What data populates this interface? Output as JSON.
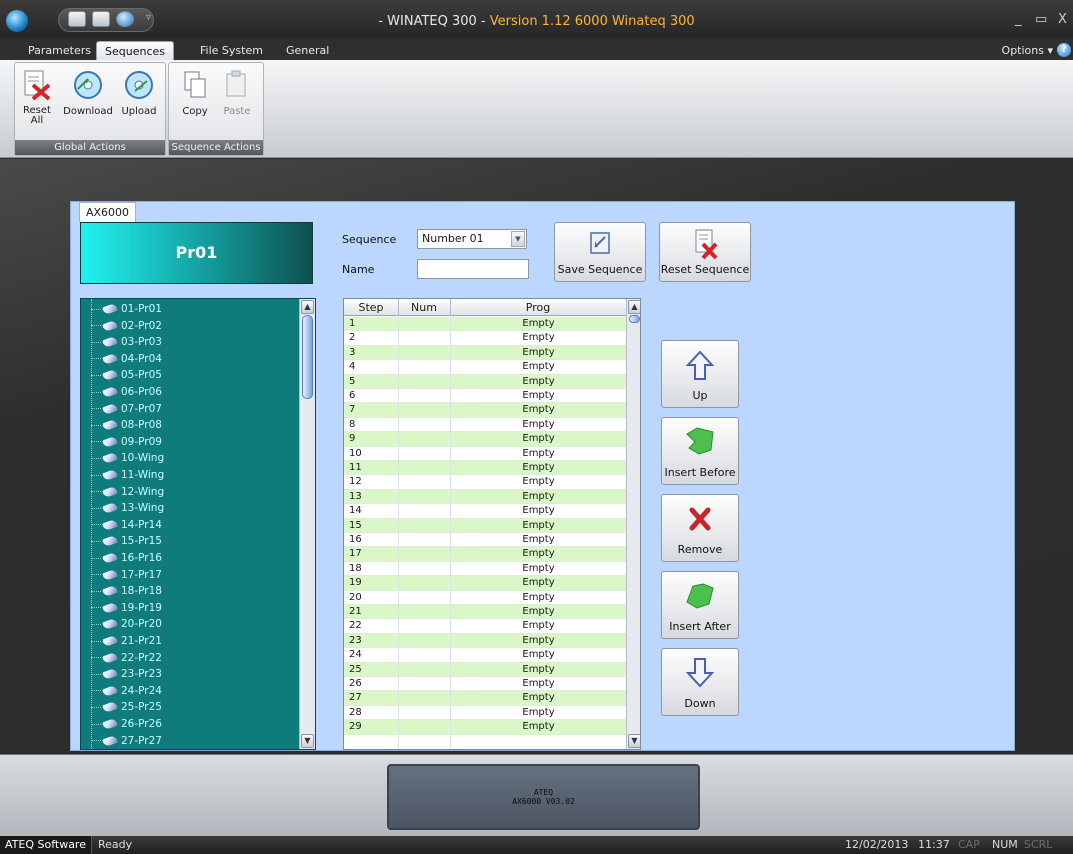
{
  "window": {
    "title_prefix": "- WINATEQ 300 -",
    "title_version": "Version 1.12 6000 Winateq 300",
    "minimize": "_",
    "maximize": "▭",
    "close": "X"
  },
  "tabs": [
    {
      "label": "Parameters"
    },
    {
      "label": "Sequences"
    },
    {
      "label": "File System"
    },
    {
      "label": "General"
    }
  ],
  "options_label": "Options ▾",
  "ribbon": {
    "global_actions": {
      "label": "Global Actions",
      "buttons": [
        {
          "label": "Reset\nAll",
          "icon": "reset-all-icon"
        },
        {
          "label": "Download",
          "icon": "download-disc-icon"
        },
        {
          "label": "Upload",
          "icon": "upload-disc-icon"
        }
      ]
    },
    "sequence_actions": {
      "label": "Sequence Actions",
      "buttons": [
        {
          "label": "Copy",
          "icon": "copy-icon"
        },
        {
          "label": "Paste",
          "icon": "paste-icon"
        }
      ]
    }
  },
  "device_tab": "AX6000",
  "program_header": "Pr01",
  "tree_items": [
    "01-Pr01",
    "02-Pr02",
    "03-Pr03",
    "04-Pr04",
    "05-Pr05",
    "06-Pr06",
    "07-Pr07",
    "08-Pr08",
    "09-Pr09",
    "10-Wing",
    "11-Wing",
    "12-Wing",
    "13-Wing",
    "14-Pr14",
    "15-Pr15",
    "16-Pr16",
    "17-Pr17",
    "18-Pr18",
    "19-Pr19",
    "20-Pr20",
    "21-Pr21",
    "22-Pr22",
    "23-Pr23",
    "24-Pr24",
    "25-Pr25",
    "26-Pr26",
    "27-Pr27"
  ],
  "sequence": {
    "label": "Sequence",
    "value": "Number 01",
    "name_label": "Name",
    "name_value": ""
  },
  "buttons": {
    "save_sequence": "Save Sequence",
    "reset_sequence": "Reset Sequence",
    "up": "Up",
    "insert_before": "Insert Before",
    "remove": "Remove",
    "insert_after": "Insert After",
    "down": "Down"
  },
  "grid": {
    "columns": [
      "Step",
      "Num",
      "Prog"
    ],
    "rows": [
      {
        "step": "1",
        "num": "",
        "prog": "Empty"
      },
      {
        "step": "2",
        "num": "",
        "prog": "Empty"
      },
      {
        "step": "3",
        "num": "",
        "prog": "Empty"
      },
      {
        "step": "4",
        "num": "",
        "prog": "Empty"
      },
      {
        "step": "5",
        "num": "",
        "prog": "Empty"
      },
      {
        "step": "6",
        "num": "",
        "prog": "Empty"
      },
      {
        "step": "7",
        "num": "",
        "prog": "Empty"
      },
      {
        "step": "8",
        "num": "",
        "prog": "Empty"
      },
      {
        "step": "9",
        "num": "",
        "prog": "Empty"
      },
      {
        "step": "10",
        "num": "",
        "prog": "Empty"
      },
      {
        "step": "11",
        "num": "",
        "prog": "Empty"
      },
      {
        "step": "12",
        "num": "",
        "prog": "Empty"
      },
      {
        "step": "13",
        "num": "",
        "prog": "Empty"
      },
      {
        "step": "14",
        "num": "",
        "prog": "Empty"
      },
      {
        "step": "15",
        "num": "",
        "prog": "Empty"
      },
      {
        "step": "16",
        "num": "",
        "prog": "Empty"
      },
      {
        "step": "17",
        "num": "",
        "prog": "Empty"
      },
      {
        "step": "18",
        "num": "",
        "prog": "Empty"
      },
      {
        "step": "19",
        "num": "",
        "prog": "Empty"
      },
      {
        "step": "20",
        "num": "",
        "prog": "Empty"
      },
      {
        "step": "21",
        "num": "",
        "prog": "Empty"
      },
      {
        "step": "22",
        "num": "",
        "prog": "Empty"
      },
      {
        "step": "23",
        "num": "",
        "prog": "Empty"
      },
      {
        "step": "24",
        "num": "",
        "prog": "Empty"
      },
      {
        "step": "25",
        "num": "",
        "prog": "Empty"
      },
      {
        "step": "26",
        "num": "",
        "prog": "Empty"
      },
      {
        "step": "27",
        "num": "",
        "prog": "Empty"
      },
      {
        "step": "28",
        "num": "",
        "prog": "Empty"
      },
      {
        "step": "29",
        "num": "",
        "prog": "Empty"
      }
    ]
  },
  "lcd": {
    "line1": "ATEQ",
    "line2": "AX6000 V03.02"
  },
  "status": {
    "app": "ATEQ Software",
    "state": "Ready",
    "date": "12/02/2013",
    "time": "11:37",
    "cap": "CAP",
    "num": "NUM",
    "scrl": "SCRL"
  },
  "colors": {
    "tree_bg": "#0f7b7b",
    "panel_bg": "#bcd7ff",
    "row_alt": "#d9f7c7",
    "title_accent": "#ffb43a"
  }
}
